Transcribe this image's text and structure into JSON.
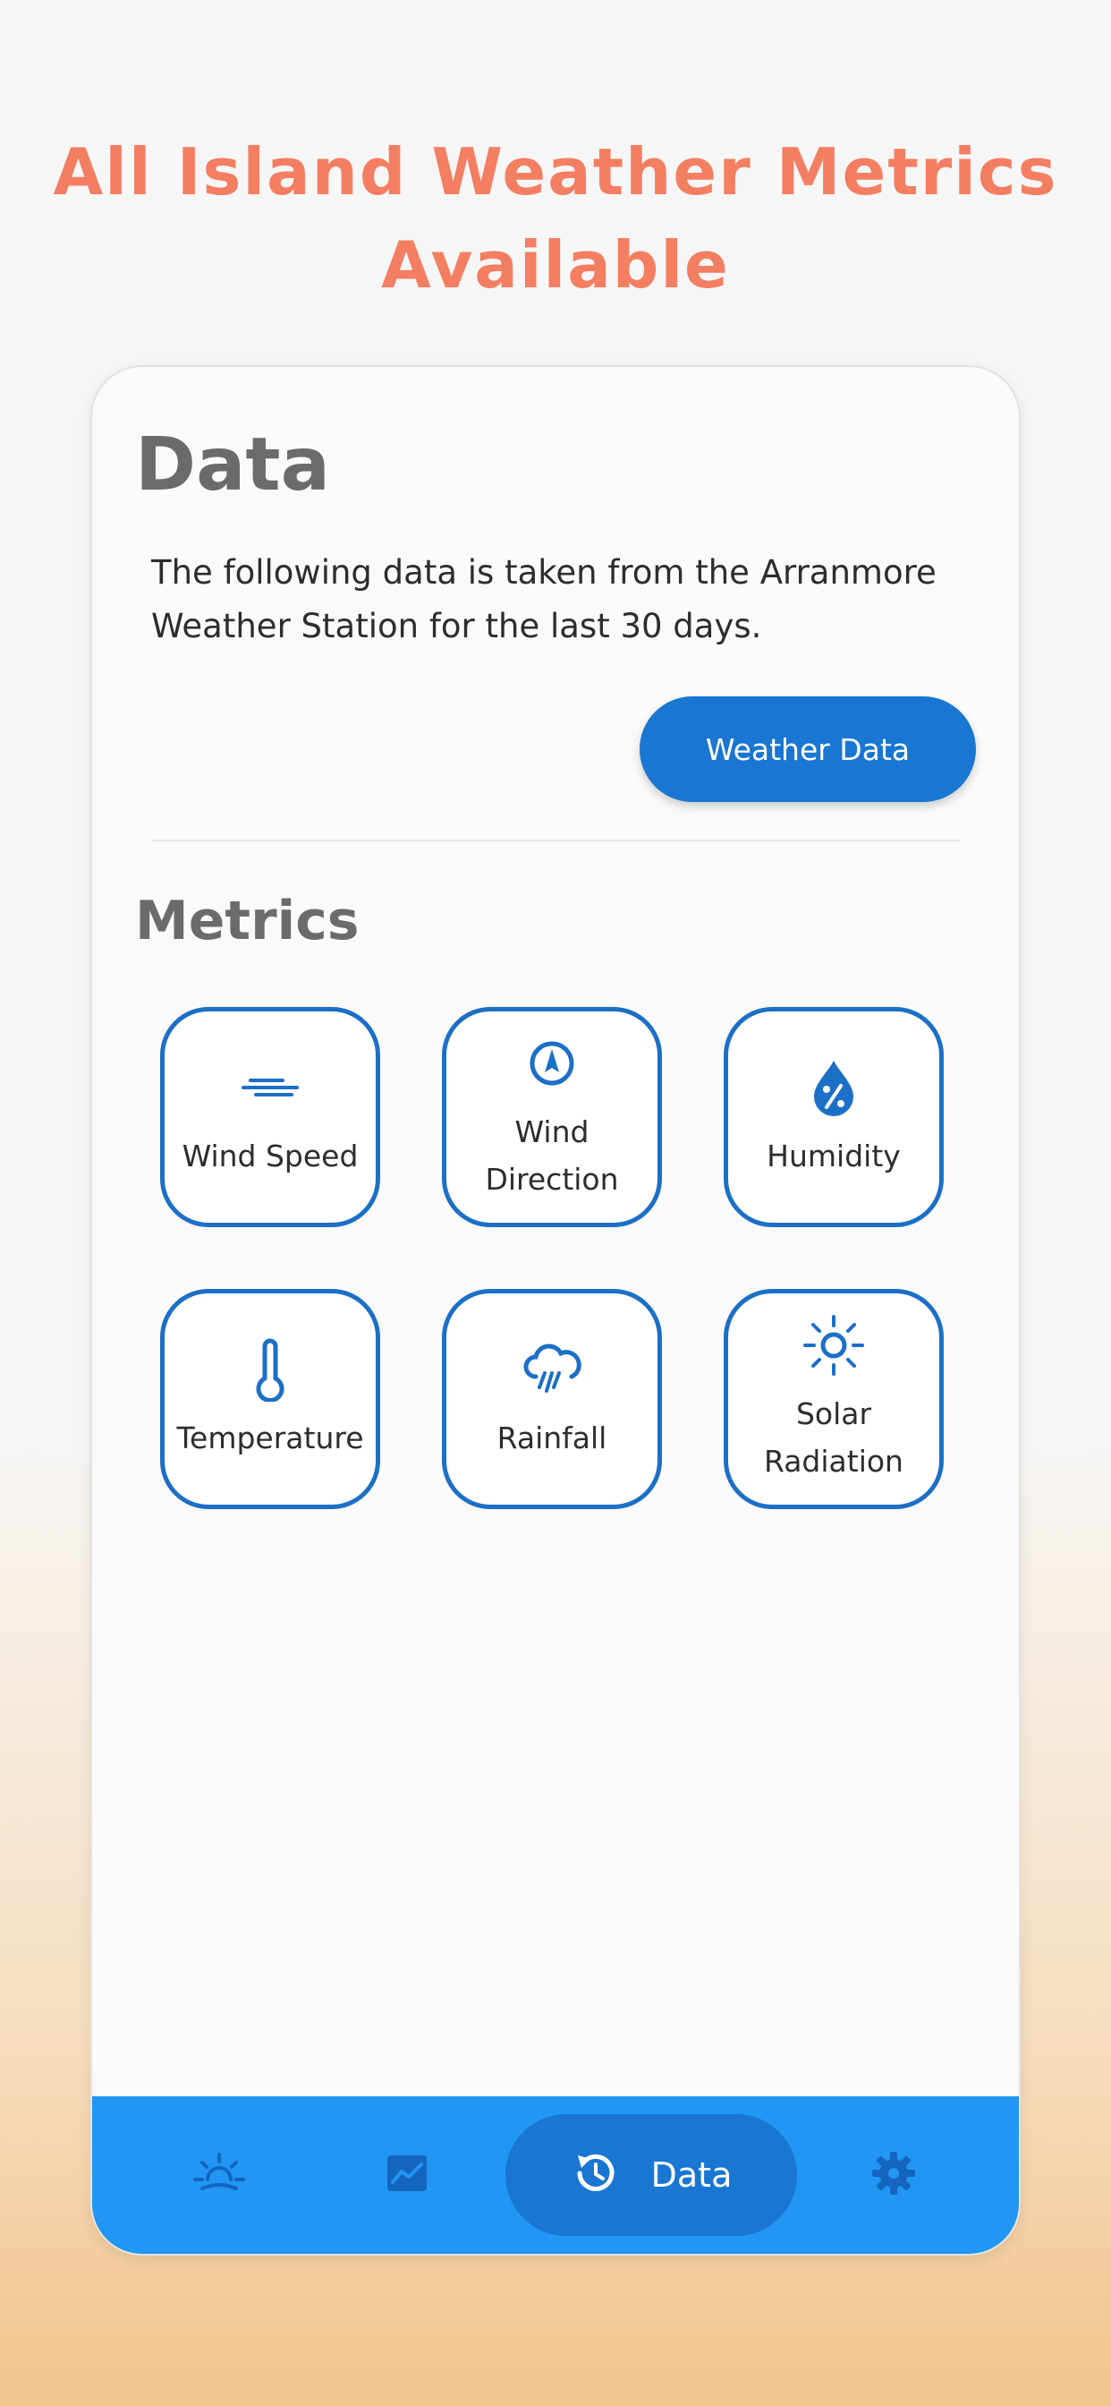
{
  "headline": {
    "line1": "All Island Weather Metrics",
    "line2": "Available"
  },
  "data_section": {
    "title": "Data",
    "description": "The following data is taken from the Arranmore Weather Station for the last 30 days.",
    "button_label": "Weather Data"
  },
  "metrics_section": {
    "title": "Metrics",
    "items": [
      {
        "label": "Wind Speed",
        "icon": "wind-icon"
      },
      {
        "label": "Wind Direction",
        "icon": "compass-icon"
      },
      {
        "label": "Humidity",
        "icon": "humidity-drop-icon"
      },
      {
        "label": "Temperature",
        "icon": "thermometer-icon"
      },
      {
        "label": "Rainfall",
        "icon": "rain-cloud-icon"
      },
      {
        "label": "Solar Radiation",
        "icon": "sun-icon"
      }
    ]
  },
  "bottom_nav": {
    "items": [
      {
        "icon": "sunrise-icon"
      },
      {
        "icon": "chart-icon"
      },
      {
        "icon": "history-icon",
        "label": "Data",
        "active": true
      },
      {
        "icon": "gear-icon"
      }
    ]
  },
  "colors": {
    "headline": "#f47e62",
    "accent": "#1976d2",
    "nav_bar": "#2196f3",
    "tile_border": "#1c6fc6"
  }
}
